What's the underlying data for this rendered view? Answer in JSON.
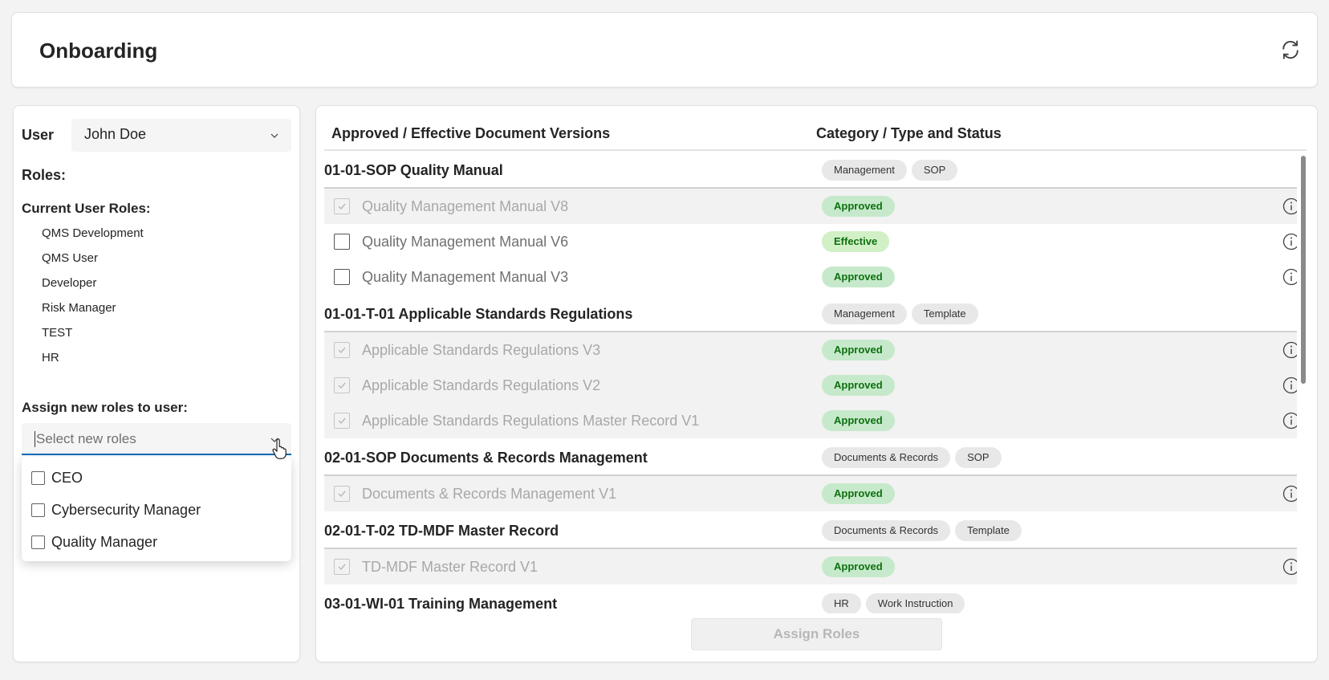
{
  "header": {
    "title": "Onboarding"
  },
  "user_panel": {
    "user_label": "User",
    "user_value": "John Doe",
    "roles_label": "Roles:",
    "current_roles_label": "Current User Roles:",
    "current_roles": [
      "QMS Development",
      "QMS User",
      "Developer",
      "Risk Manager",
      "TEST",
      "HR"
    ],
    "assign_label": "Assign new roles to user:",
    "role_placeholder": "Select new roles",
    "role_options": [
      "CEO",
      "Cybersecurity Manager",
      "Quality Manager"
    ]
  },
  "documents": {
    "col_versions": "Approved / Effective Document Versions",
    "col_category": "Category / Type and Status",
    "groups": [
      {
        "title": "01-01-SOP Quality Manual",
        "tags": [
          "Management",
          "SOP"
        ],
        "versions": [
          {
            "name": "Quality Management Manual V8",
            "status": "Approved",
            "locked": true
          },
          {
            "name": "Quality Management Manual V6",
            "status": "Effective",
            "locked": false
          },
          {
            "name": "Quality Management Manual V3",
            "status": "Approved",
            "locked": false
          }
        ]
      },
      {
        "title": "01-01-T-01 Applicable Standards Regulations",
        "tags": [
          "Management",
          "Template"
        ],
        "versions": [
          {
            "name": "Applicable Standards Regulations V3",
            "status": "Approved",
            "locked": true
          },
          {
            "name": "Applicable Standards Regulations V2",
            "status": "Approved",
            "locked": true
          },
          {
            "name": "Applicable Standards Regulations Master Record V1",
            "status": "Approved",
            "locked": true
          }
        ]
      },
      {
        "title": "02-01-SOP Documents & Records Management",
        "tags": [
          "Documents & Records",
          "SOP"
        ],
        "versions": [
          {
            "name": "Documents & Records Management V1",
            "status": "Approved",
            "locked": true
          }
        ]
      },
      {
        "title": "02-01-T-02 TD-MDF Master Record",
        "tags": [
          "Documents & Records",
          "Template"
        ],
        "versions": [
          {
            "name": "TD-MDF Master Record V1",
            "status": "Approved",
            "locked": true
          }
        ]
      },
      {
        "title": "03-01-WI-01 Training Management",
        "tags": [
          "HR",
          "Work Instruction"
        ],
        "versions": []
      }
    ]
  },
  "actions": {
    "assign_button": "Assign Roles"
  },
  "colors": {
    "accent": "#0f6cbd",
    "approved_bg": "#c6e9cb",
    "approved_text": "#0e700e",
    "tag_bg": "#e8e8e8"
  },
  "icons": {
    "refresh": "refresh-icon",
    "chevron": "chevron-down-icon",
    "info": "info-icon",
    "check": "checkmark-icon",
    "cursor": "hand-cursor-icon"
  }
}
